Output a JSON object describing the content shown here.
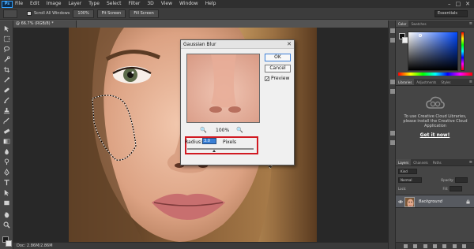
{
  "app": {
    "logo": "Ps"
  },
  "menu": [
    "File",
    "Edit",
    "Image",
    "Layer",
    "Type",
    "Select",
    "Filter",
    "3D",
    "View",
    "Window",
    "Help"
  ],
  "window_controls": [
    "–",
    "□",
    "✕"
  ],
  "options_bar": {
    "scroll_all_windows": "Scroll All Windows",
    "buttons": [
      "100%",
      "Fit Screen",
      "Fill Screen"
    ],
    "workspace": "Essentials"
  },
  "document": {
    "tab_title": "@ 66.7% (RGB/8) *",
    "status": "Doc: 2.86M/2.86M"
  },
  "dialog": {
    "title": "Gaussian Blur",
    "ok": "OK",
    "cancel": "Cancel",
    "preview_label": "Preview",
    "preview_checked": true,
    "zoom_out": "🔍",
    "zoom_in": "🔍",
    "zoom": "100%",
    "radius_label": "Radius:",
    "radius_value": "3.0",
    "radius_unit": "Pixels",
    "radius_slider_fraction": 0.4
  },
  "panels": {
    "color_tabs": [
      "Color",
      "Swatches"
    ],
    "library_tabs": [
      "Libraries",
      "Adjustments",
      "Styles"
    ],
    "library_message": "To use Creative Cloud Libraries, please install the Creative Cloud Application",
    "library_link": "Get it now!",
    "layers_tabs": [
      "Layers",
      "Channels",
      "Paths"
    ],
    "kind_filter": "Kind",
    "blend_mode": "Normal",
    "opacity_label": "Opacity:",
    "lock_label": "Lock:",
    "fill_label": "Fill:",
    "layer_name": "Background"
  },
  "colors": {
    "accent_highlight": "#d11a22",
    "selected_input": "#3a7fd4",
    "ps_blue": "#2fa0ff"
  }
}
